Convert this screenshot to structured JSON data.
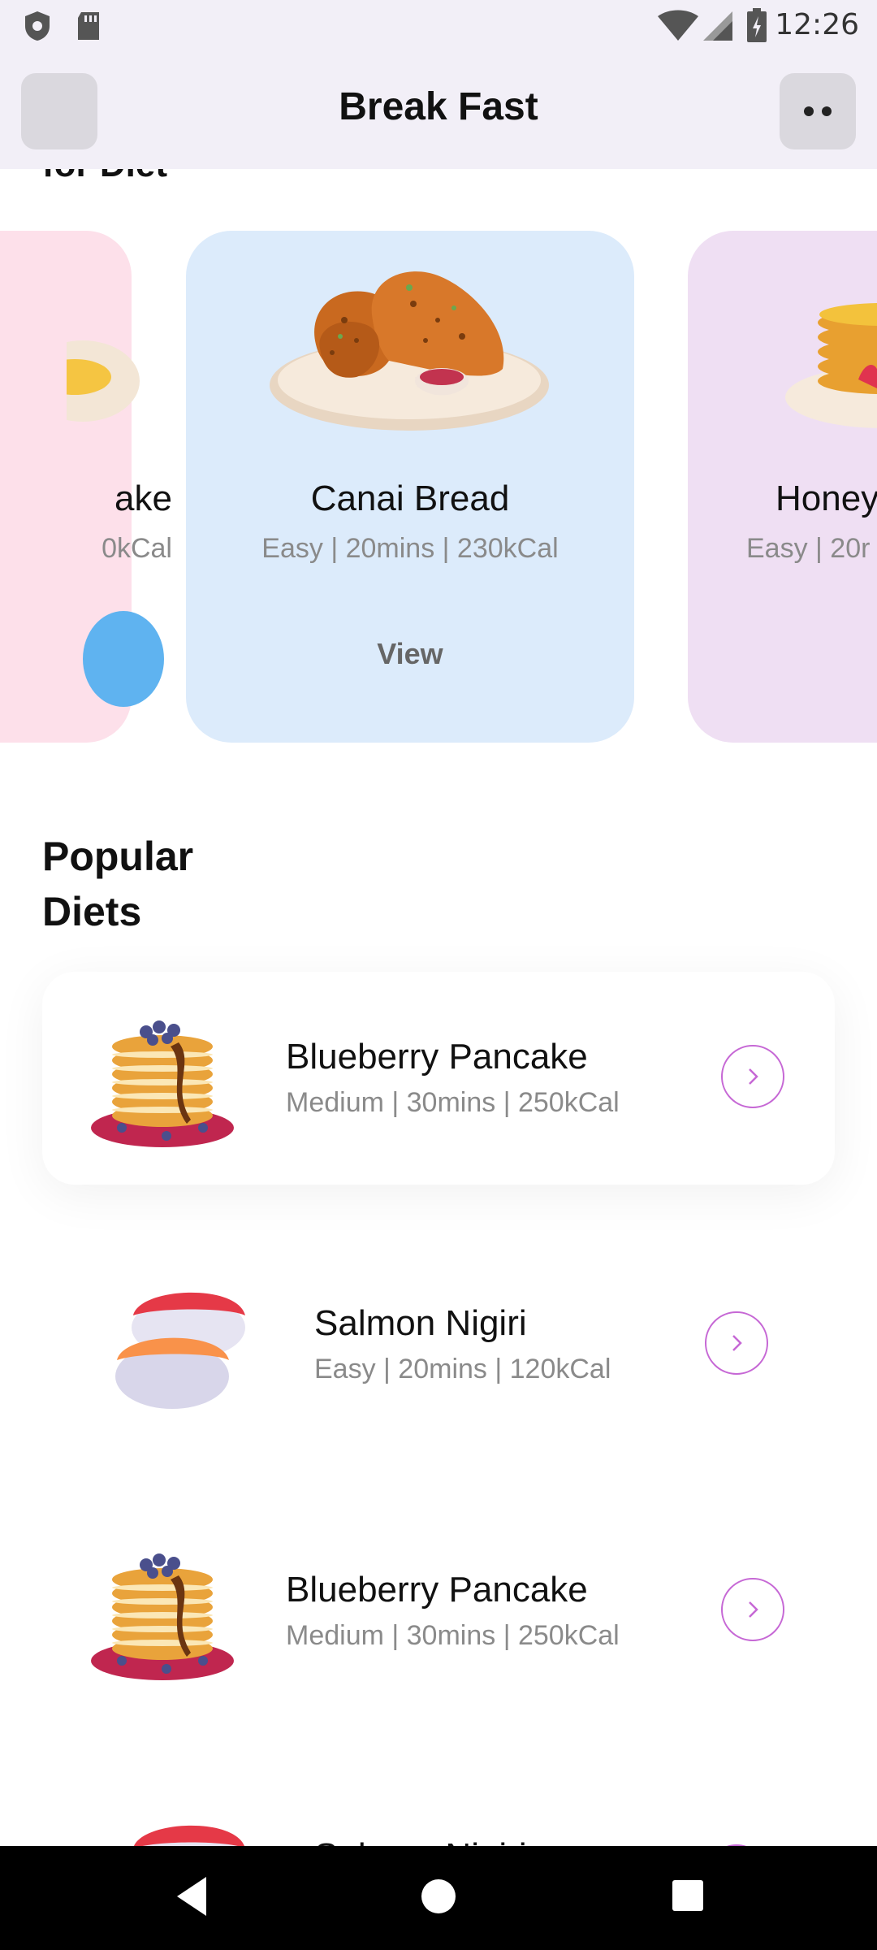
{
  "status_bar": {
    "time": "12:26",
    "icons": [
      "shield-icon",
      "sd-card-icon",
      "wifi-icon",
      "signal-icon",
      "battery-icon"
    ]
  },
  "app_bar": {
    "title": "Break Fast",
    "back_icon": "back-icon",
    "more_icon": "more-icon"
  },
  "section_peek": "for Diet",
  "carousel": {
    "left_card": {
      "name": "ake",
      "meta": "0kCal"
    },
    "center_card": {
      "name": "Canai Bread",
      "meta": "Easy | 20mins | 230kCal",
      "button": "View"
    },
    "right_card": {
      "name": "Honey",
      "meta": "Easy | 20r"
    }
  },
  "popular": {
    "title": "Popular Diets",
    "items": [
      {
        "name": "Blueberry Pancake",
        "meta": "Medium | 30mins | 250kCal",
        "image": "pancake-image"
      },
      {
        "name": "Salmon Nigiri",
        "meta": "Easy | 20mins | 120kCal",
        "image": "sushi-image"
      },
      {
        "name": "Blueberry Pancake",
        "meta": "Medium | 30mins | 250kCal",
        "image": "pancake-image"
      },
      {
        "name": "Salmon Nigiri",
        "meta": "",
        "image": "sushi-image"
      }
    ]
  },
  "nav_bar": {
    "buttons": [
      "back-triangle-icon",
      "home-circle-icon",
      "recents-square-icon"
    ]
  },
  "colors": {
    "accent": "#c668d5",
    "card_pink": "#fde0ea",
    "card_blue": "#dcebfb",
    "card_purple": "#efdff3",
    "app_bar_bg": "#f2eff7"
  }
}
